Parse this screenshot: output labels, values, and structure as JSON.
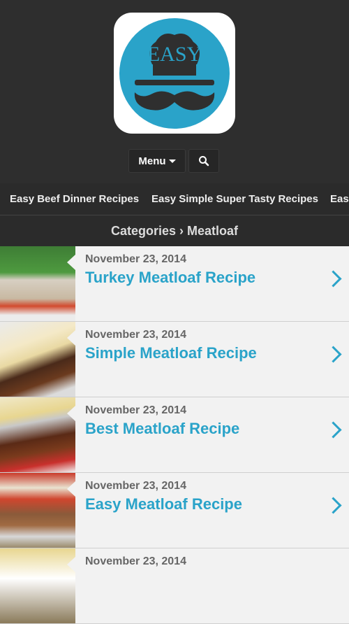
{
  "logo": {
    "text": "EASY",
    "bg_color": "#2aa3c9"
  },
  "header": {
    "menu_label": "Menu",
    "search_icon": "search-icon"
  },
  "nav": {
    "items": [
      "Easy Beef Dinner Recipes",
      "Easy Simple Super Tasty Recipes",
      "Easy"
    ]
  },
  "breadcrumb": "Categories › Meatloaf",
  "posts": [
    {
      "date": "November 23, 2014",
      "title": "Turkey Meatloaf Recipe"
    },
    {
      "date": "November 23, 2014",
      "title": "Simple Meatloaf Recipe"
    },
    {
      "date": "November 23, 2014",
      "title": "Best Meatloaf Recipe"
    },
    {
      "date": "November 23, 2014",
      "title": "Easy Meatloaf Recipe"
    },
    {
      "date": "November 23, 2014",
      "title": ""
    }
  ],
  "colors": {
    "accent": "#2aa3c9",
    "header_bg": "#2e2e2e",
    "row_bg": "#f2f2f2"
  }
}
